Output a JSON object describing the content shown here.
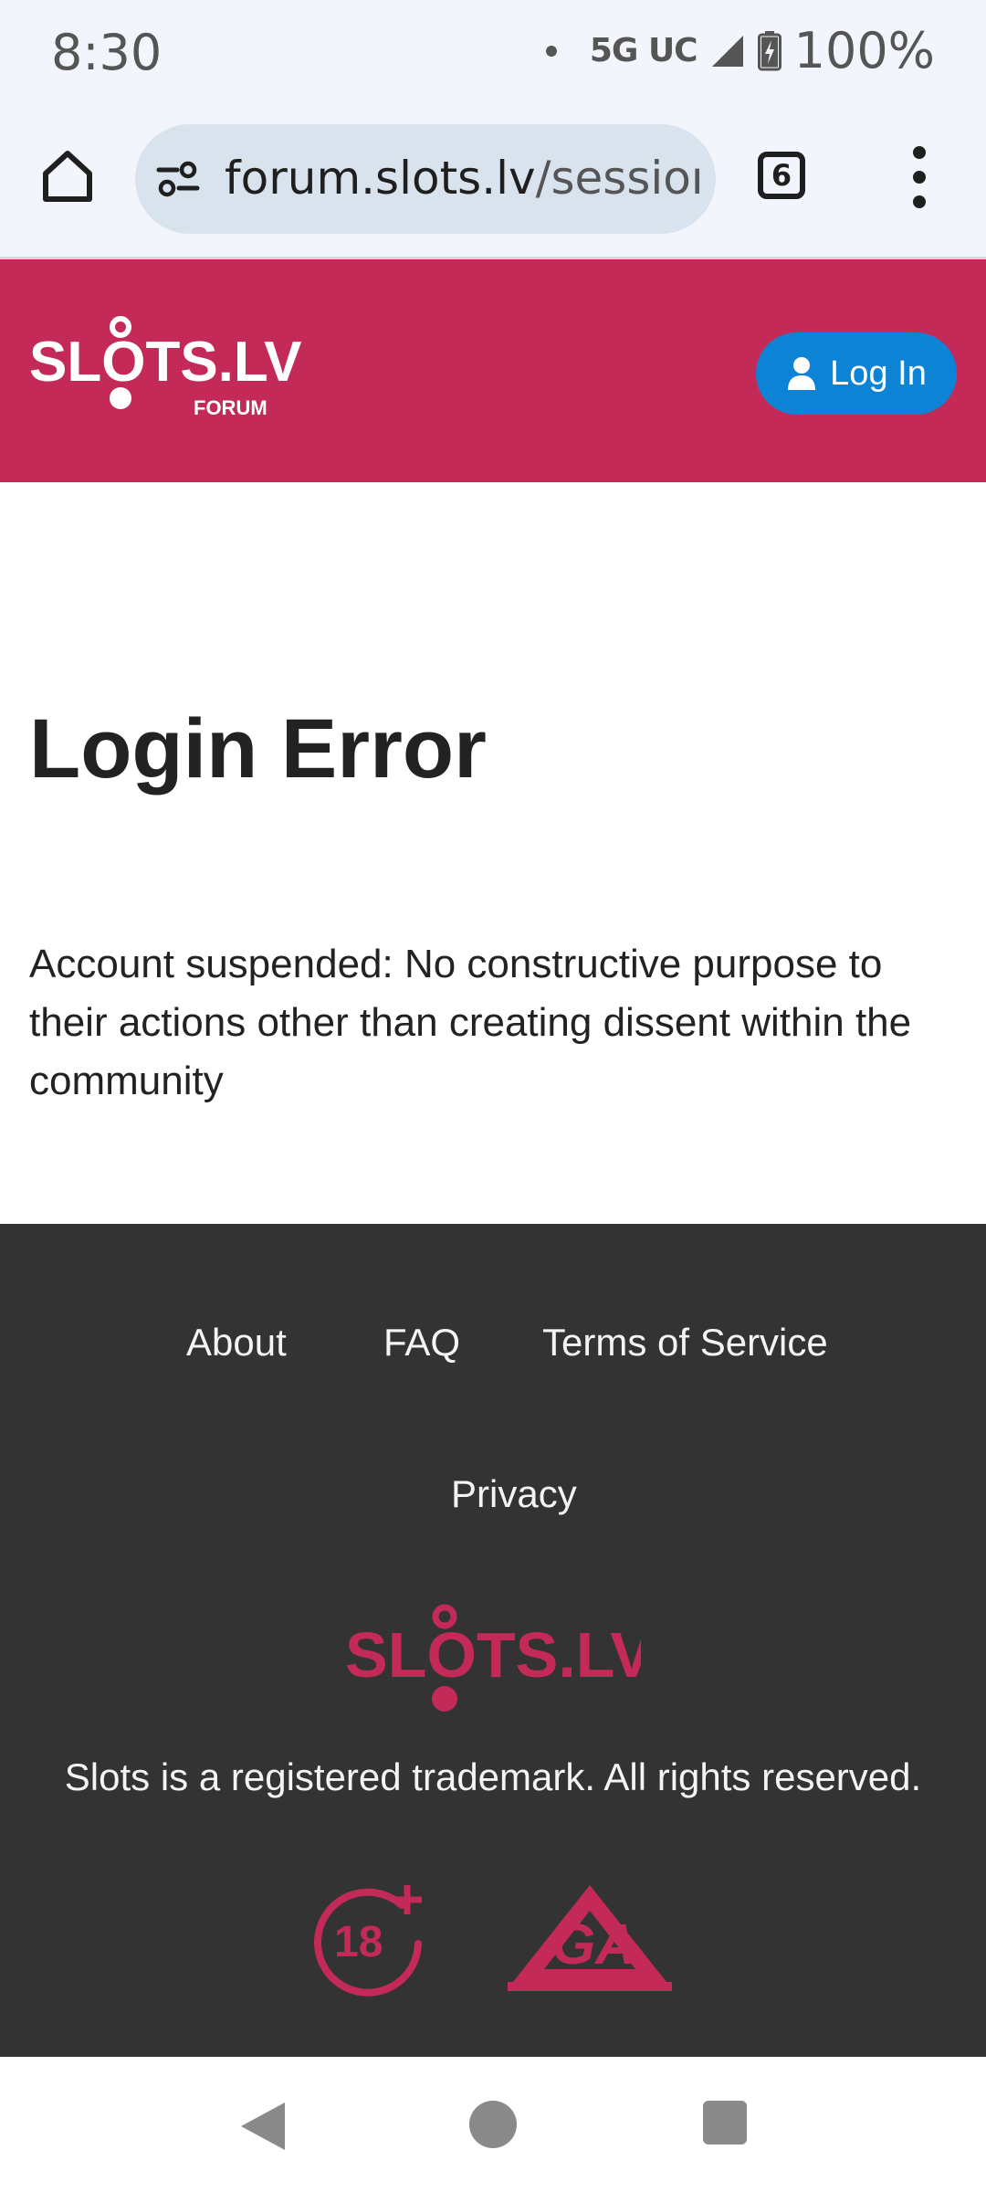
{
  "status_bar": {
    "time": "8:30",
    "network": "5G UC",
    "battery": "100%"
  },
  "browser": {
    "url_host": "forum.slots.lv",
    "url_path": "/session/",
    "tab_count": "6"
  },
  "header": {
    "logo_text": "SLOTS.LV",
    "logo_subtitle": "FORUM",
    "login_label": "Log In"
  },
  "main": {
    "title": "Login Error",
    "message": "Account suspended: No constructive purpose to their actions other than creating dissent within the community"
  },
  "footer": {
    "links": [
      "About",
      "FAQ",
      "Terms of Service",
      "Privacy"
    ],
    "logo_text": "SLOTS.LV",
    "trademark": "Slots is a registered trademark. All rights reserved.",
    "badges": [
      "18+",
      "GA"
    ]
  },
  "colors": {
    "brand": "#c42a58",
    "login_button": "#0d83d6",
    "footer_bg": "#333333"
  },
  "icons": [
    "home-icon",
    "site-info-icon",
    "tabs-icon",
    "menu-icon",
    "user-icon",
    "age-restriction-icon",
    "gamblers-anonymous-icon",
    "nav-back-icon",
    "nav-home-icon",
    "nav-recents-icon"
  ]
}
